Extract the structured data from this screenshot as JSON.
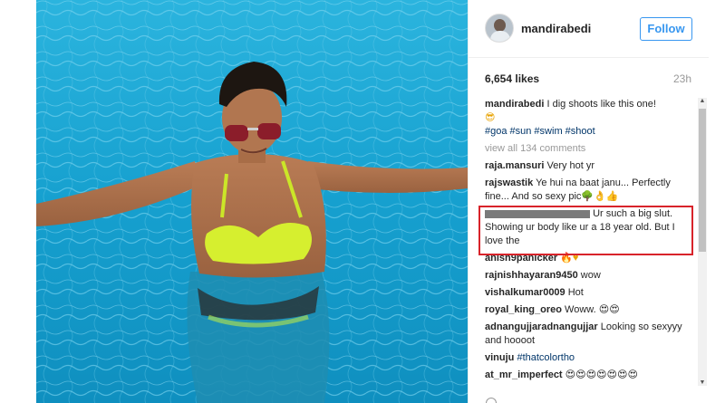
{
  "post": {
    "username": "mandirabedi",
    "follow_label": "Follow",
    "likes": "6,654 likes",
    "time_ago": "23h"
  },
  "caption": {
    "user": "mandirabedi",
    "text": "I dig shoots like this one!",
    "emoji": "😎",
    "hashtags": "#goa #sun #swim #shoot"
  },
  "view_all": "view all 134 comments",
  "comments": [
    {
      "user": "raja.mansuri",
      "text": "Very hot yr"
    },
    {
      "user": "rajswastik",
      "text": "Ye hui na baat janu... Perfectly fine... And so sexy pic🌳👌👍"
    },
    {
      "user": "",
      "text": "Ur such a big slut. Showing ur body like ur a 18 year old. But I love the"
    },
    {
      "user": "anish9panicker",
      "text": "🔥♥"
    },
    {
      "user": "rajnishhayaran9450",
      "text": "wow"
    },
    {
      "user": "vishalkumar0009",
      "text": "Hot"
    },
    {
      "user": "royal_king_oreo",
      "text": "Woww. 😍😍"
    },
    {
      "user": "adnangujjaradnangujjar",
      "text": "Looking so sexyyy and hoooot"
    },
    {
      "user": "vinuju",
      "text": "#thatcolortho"
    },
    {
      "user": "at_mr_imperfect",
      "text": "😍😍😍😍😍😍😍"
    }
  ],
  "colors": {
    "accent": "#3897f0",
    "highlight_box": "#d8232a",
    "hashtag": "#003569"
  }
}
